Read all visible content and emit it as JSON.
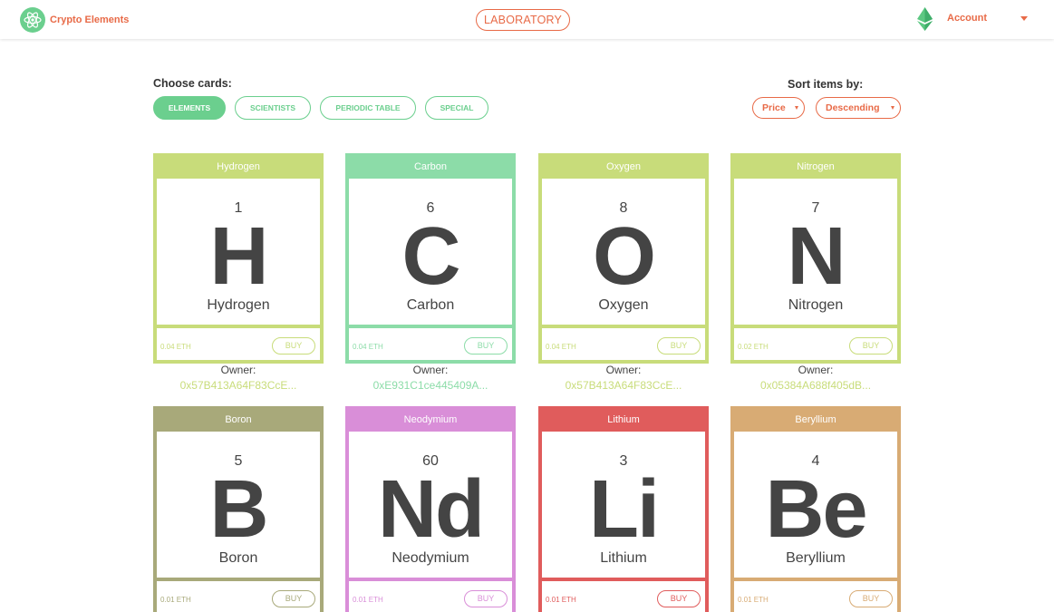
{
  "header": {
    "brand": "Crypto Elements",
    "center_button": "LABORATORY",
    "account": "Account"
  },
  "filters": {
    "label": "Choose cards:",
    "buttons": [
      "ELEMENTS",
      "SCIENTISTS",
      "PERIODIC TABLE",
      "SPECIAL"
    ],
    "active": "ELEMENTS"
  },
  "sort": {
    "label": "Sort items by:",
    "field": "Price",
    "order": "Descending"
  },
  "buy_label": "BUY",
  "owner_label": "Owner:",
  "colors": {
    "accent": "#e86a47",
    "green": "#6bcf8e"
  },
  "cards": [
    {
      "name": "Hydrogen",
      "number": "1",
      "symbol": "H",
      "price": "0.04 ETH",
      "owner": "0x57B413A64F83CcE...",
      "color": "#c8dc7a"
    },
    {
      "name": "Carbon",
      "number": "6",
      "symbol": "C",
      "price": "0.04 ETH",
      "owner": "0xE931C1ce445409A...",
      "color": "#8cdca8"
    },
    {
      "name": "Oxygen",
      "number": "8",
      "symbol": "O",
      "price": "0.04 ETH",
      "owner": "0x57B413A64F83CcE...",
      "color": "#c8dc7a"
    },
    {
      "name": "Nitrogen",
      "number": "7",
      "symbol": "N",
      "price": "0.02 ETH",
      "owner": "0x05384A688f405dB...",
      "color": "#c8dc7a"
    },
    {
      "name": "Boron",
      "number": "5",
      "symbol": "B",
      "price": "0.01 ETH",
      "owner": "",
      "color": "#a8a97a"
    },
    {
      "name": "Neodymium",
      "number": "60",
      "symbol": "Nd",
      "price": "0.01 ETH",
      "owner": "",
      "color": "#d98ed8"
    },
    {
      "name": "Lithium",
      "number": "3",
      "symbol": "Li",
      "price": "0.01 ETH",
      "owner": "",
      "color": "#e05c5c"
    },
    {
      "name": "Beryllium",
      "number": "4",
      "symbol": "Be",
      "price": "0.01 ETH",
      "owner": "",
      "color": "#d8ab74"
    }
  ]
}
